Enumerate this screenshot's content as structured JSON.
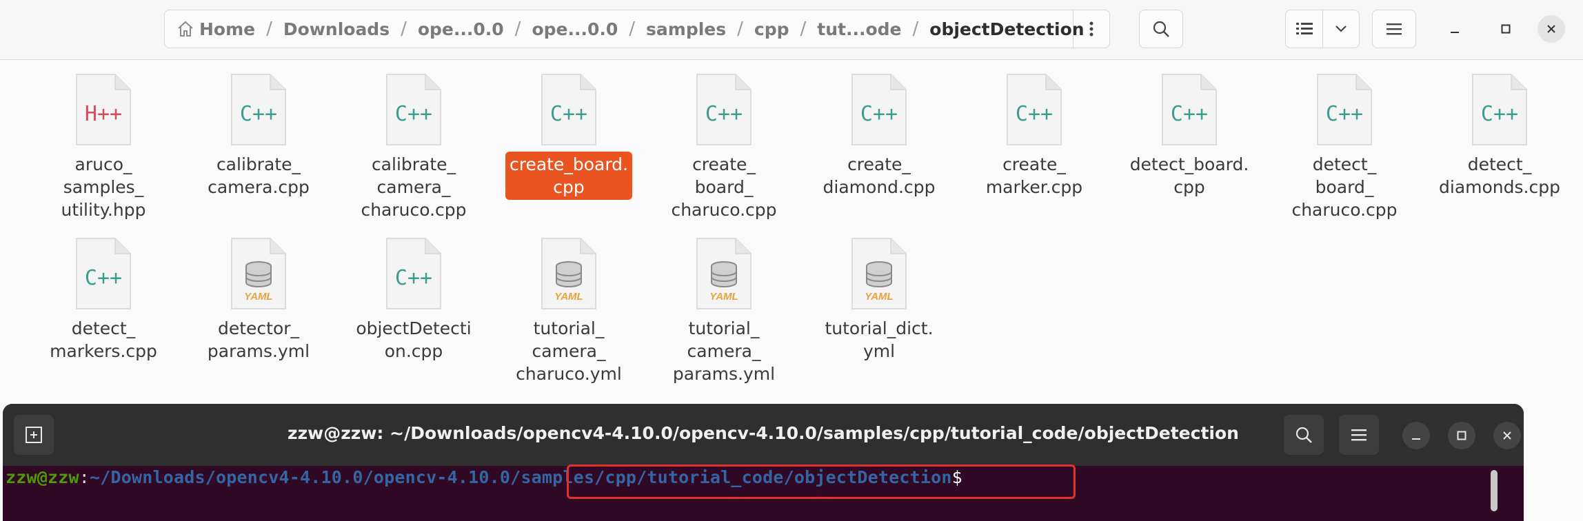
{
  "file_manager": {
    "breadcrumbs": [
      "Home",
      "Downloads",
      "ope...0.0",
      "ope...0.0",
      "samples",
      "cpp",
      "tut...ode",
      "objectDetection"
    ],
    "files": [
      {
        "name": "aruco_\nsamples_\nutility.hpp",
        "type": "H++",
        "selected": false
      },
      {
        "name": "calibrate_\ncamera.cpp",
        "type": "C++",
        "selected": false
      },
      {
        "name": "calibrate_\ncamera_\ncharuco.cpp",
        "type": "C++",
        "selected": false
      },
      {
        "name": "create_board.\ncpp",
        "type": "C++",
        "selected": true
      },
      {
        "name": "create_\nboard_\ncharuco.cpp",
        "type": "C++",
        "selected": false
      },
      {
        "name": "create_\ndiamond.cpp",
        "type": "C++",
        "selected": false
      },
      {
        "name": "create_\nmarker.cpp",
        "type": "C++",
        "selected": false
      },
      {
        "name": "detect_board.\ncpp",
        "type": "C++",
        "selected": false
      },
      {
        "name": "detect_\nboard_\ncharuco.cpp",
        "type": "C++",
        "selected": false
      },
      {
        "name": "detect_\ndiamonds.cpp",
        "type": "C++",
        "selected": false
      },
      {
        "name": "detect_\nmarkers.cpp",
        "type": "C++",
        "selected": false
      },
      {
        "name": "detector_\nparams.yml",
        "type": "YAML",
        "selected": false
      },
      {
        "name": "objectDetecti\non.cpp",
        "type": "C++",
        "selected": false
      },
      {
        "name": "tutorial_\ncamera_\ncharuco.yml",
        "type": "YAML",
        "selected": false
      },
      {
        "name": "tutorial_\ncamera_\nparams.yml",
        "type": "YAML",
        "selected": false
      },
      {
        "name": "tutorial_dict.\nyml",
        "type": "YAML",
        "selected": false
      }
    ]
  },
  "terminal": {
    "title": "zzw@zzw: ~/Downloads/opencv4-4.10.0/opencv-4.10.0/samples/cpp/tutorial_code/objectDetection",
    "prompt_user": "zzw@zzw",
    "prompt_colon": ":",
    "prompt_path": "~/Downloads/opencv4-4.10.0/opencv-4.10.0/samples/cpp/tutorial_code/objectDetection",
    "prompt_symbol": "$"
  },
  "colors": {
    "selection": "#e95420",
    "terminal_bg": "#300a24",
    "cpp_icon": "#3c9d8f",
    "hpp_icon": "#d9485f",
    "yaml_icon": "#e8a33c",
    "highlight": "#e03030"
  }
}
